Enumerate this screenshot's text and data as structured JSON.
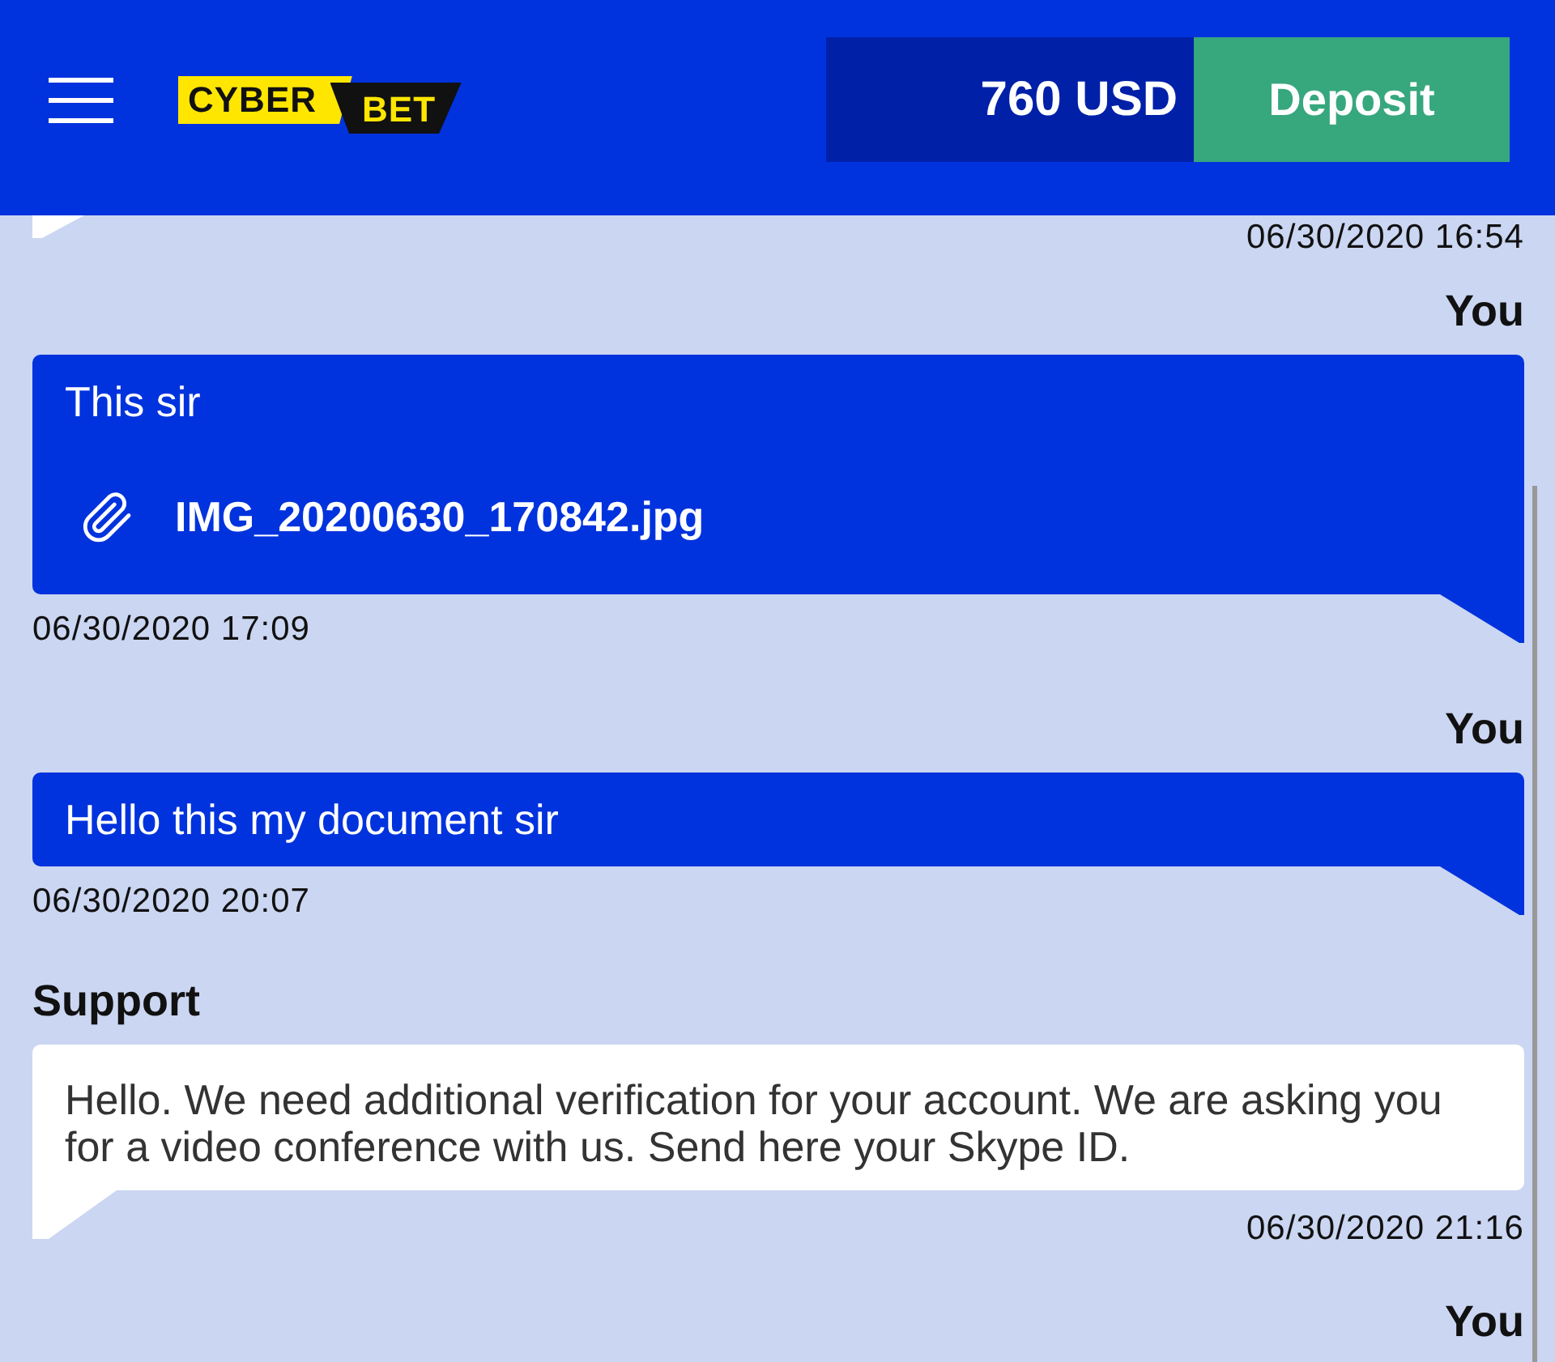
{
  "header": {
    "logo": {
      "left": "CYBER",
      "right": "BET"
    },
    "balance": "760 USD",
    "deposit_button": "Deposit"
  },
  "messages": [
    {
      "kind": "cut",
      "time": "06/30/2020 16:54"
    },
    {
      "kind": "own",
      "author": "You",
      "text": "This sir",
      "attachment": "IMG_20200630_170842.jpg",
      "time": "06/30/2020 17:09"
    },
    {
      "kind": "own",
      "author": "You",
      "text": "Hello this my document sir",
      "time": "06/30/2020 20:07"
    },
    {
      "kind": "support",
      "author": "Support",
      "text": "Hello. We need additional verification for your account. We are asking you for a video conference with us. Send here your Skype ID.",
      "time": "06/30/2020 21:16"
    },
    {
      "kind": "author_only",
      "author": "You"
    }
  ]
}
